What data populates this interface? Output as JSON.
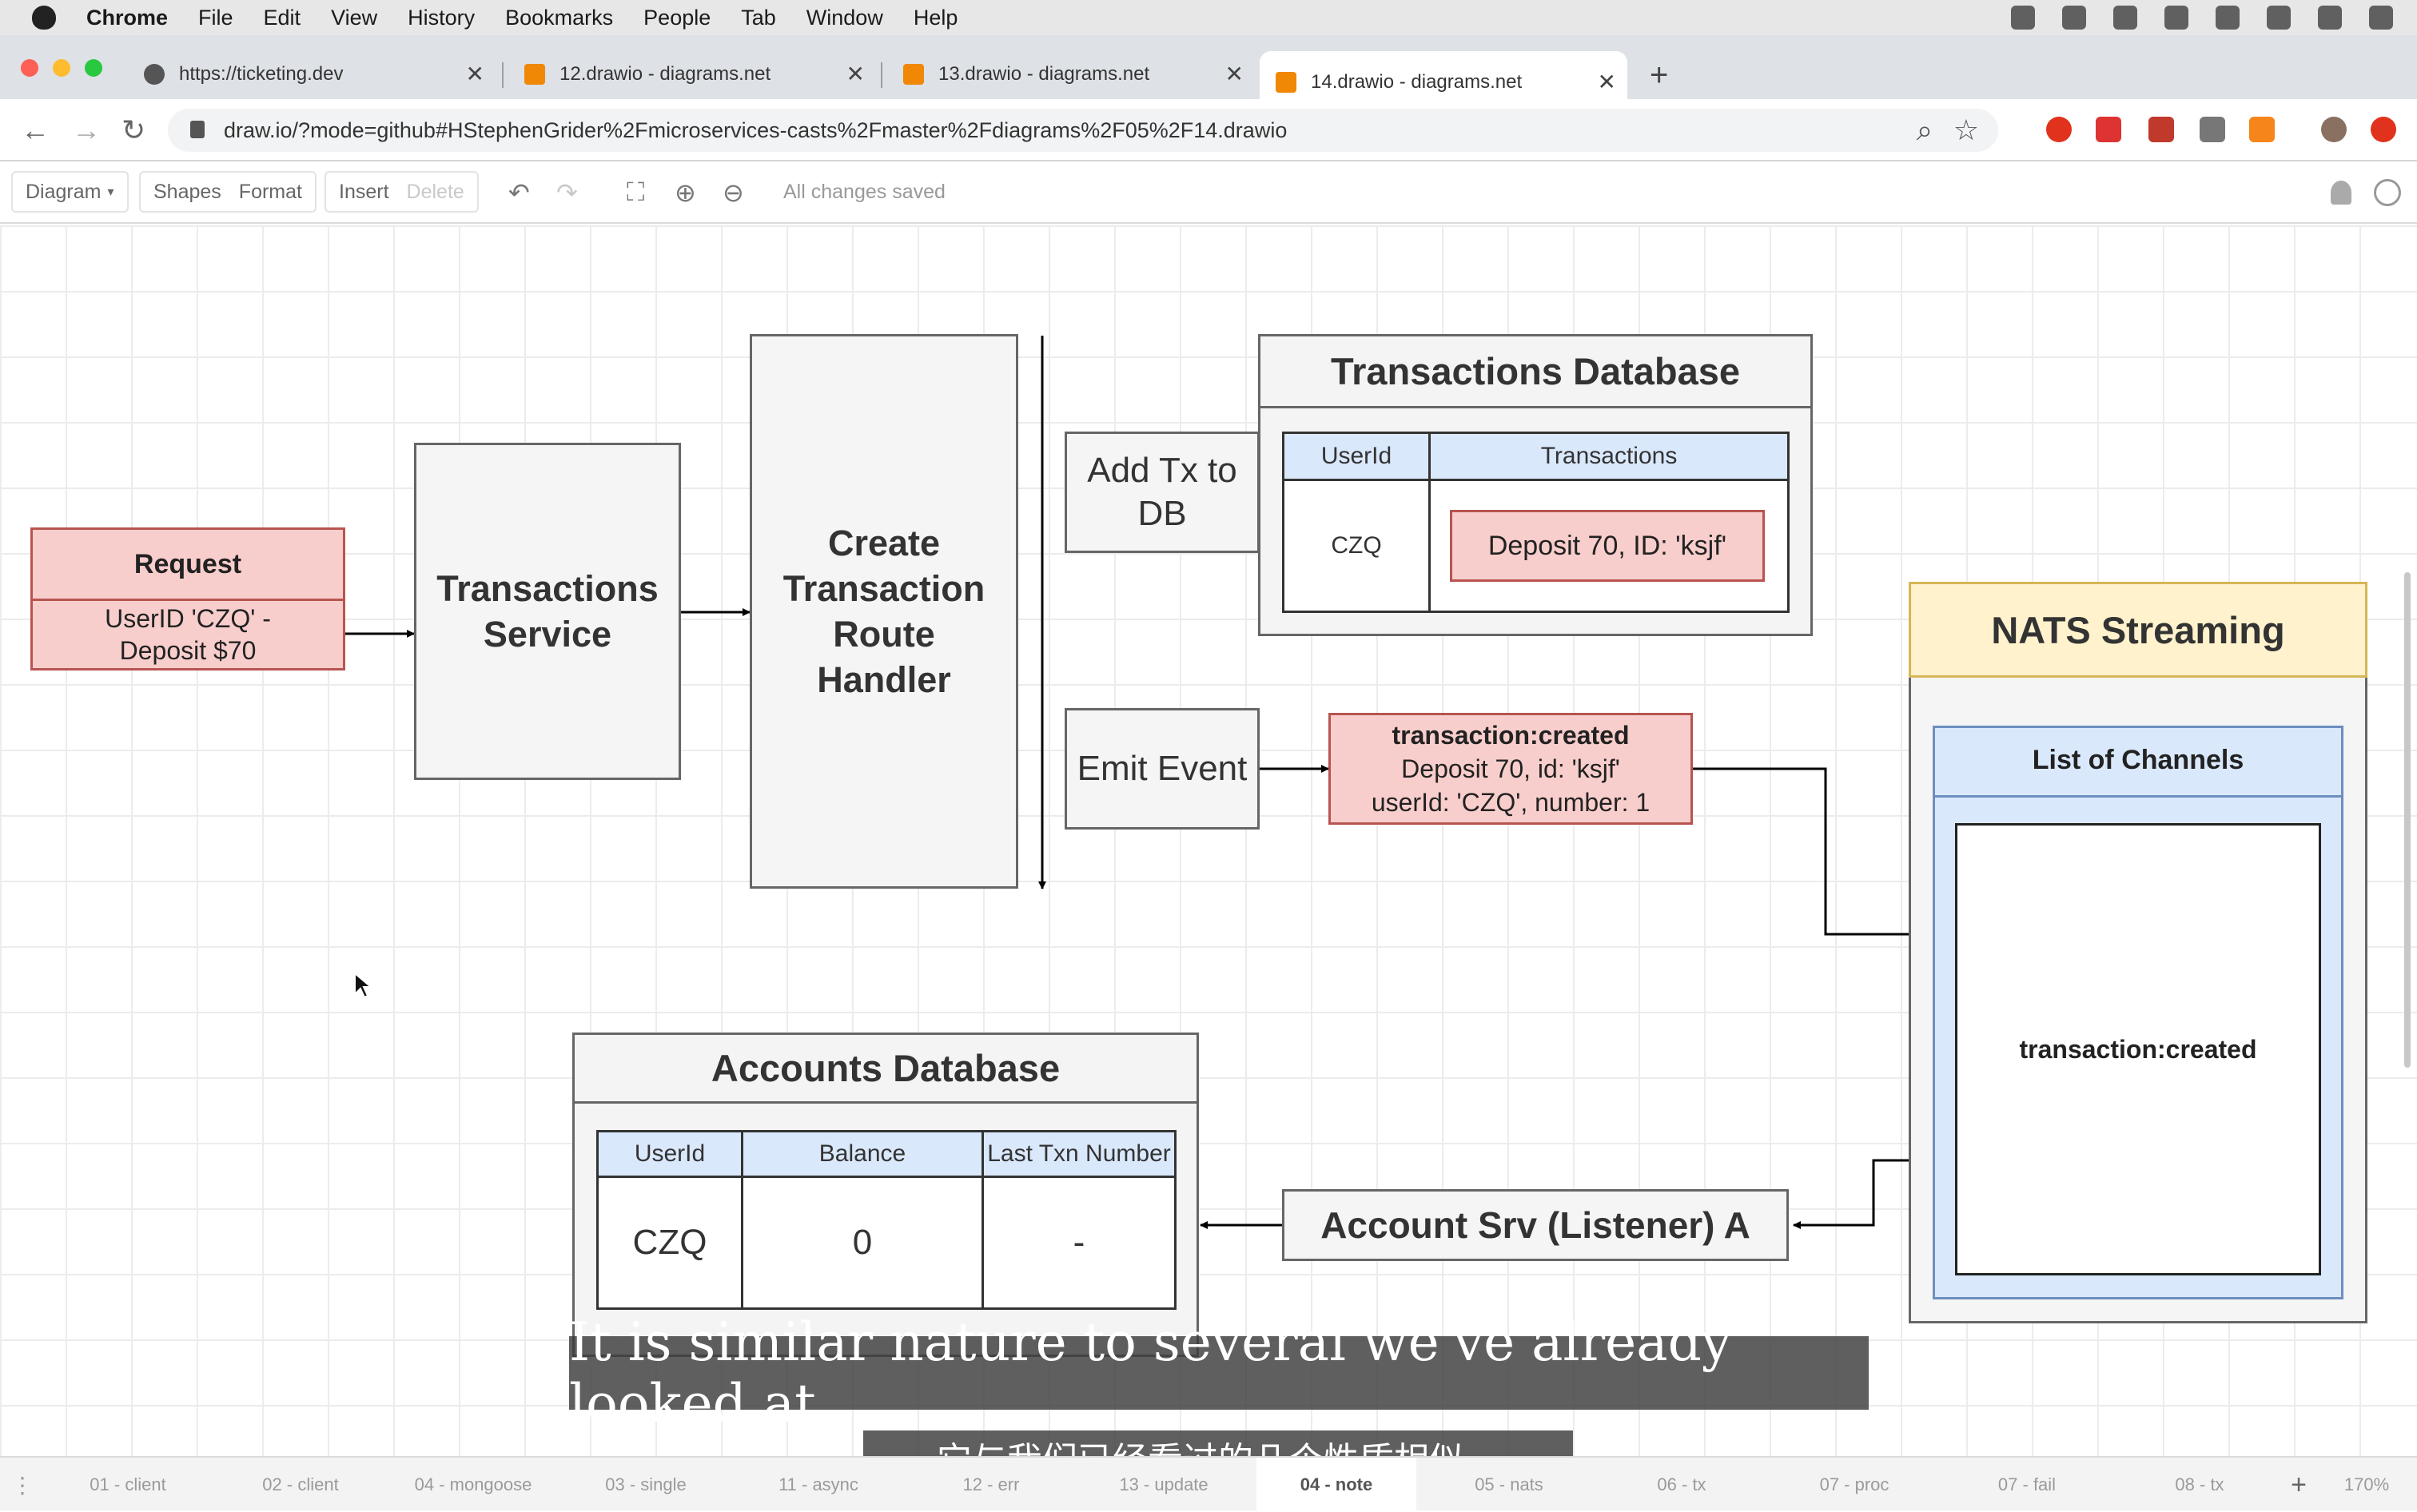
{
  "menubar": {
    "items": [
      "Chrome",
      "File",
      "Edit",
      "View",
      "History",
      "Bookmarks",
      "People",
      "Tab",
      "Window",
      "Help"
    ],
    "tray_icons": [
      "account-badge-icon",
      "cloud-icon",
      "glasses-icon",
      "wifi-icon",
      "battery-icon",
      "spotlight-icon",
      "siri-icon",
      "notification-center-icon"
    ]
  },
  "browser": {
    "tabs": [
      {
        "label": "https://ticketing.dev",
        "favicon": "globe-icon",
        "active": false
      },
      {
        "label": "12.drawio - diagrams.net",
        "favicon": "drawio-icon",
        "active": false
      },
      {
        "label": "13.drawio - diagrams.net",
        "favicon": "drawio-icon",
        "active": false
      },
      {
        "label": "14.drawio - diagrams.net",
        "favicon": "drawio-icon",
        "active": true
      }
    ],
    "close_glyph": "✕",
    "new_tab_glyph": "+",
    "url": "draw.io/?mode=github#HStephenGrider%2Fmicroservices-casts%2Fmaster%2Fdiagrams%2F05%2F14.drawio",
    "back_glyph": "←",
    "forward_glyph": "→",
    "reload_glyph": "↻",
    "zoom_glyph": "⌕",
    "star_glyph": "☆"
  },
  "drawio": {
    "toolbar": {
      "diagram": "Diagram",
      "shapes": "Shapes",
      "format": "Format",
      "insert": "Insert",
      "delete": "Delete",
      "undo_glyph": "↶",
      "redo_glyph": "↷",
      "fullscreen_glyph": "⛶",
      "zoom_in_glyph": "⊕",
      "zoom_out_glyph": "⊖",
      "status": "All changes saved"
    },
    "diagram": {
      "request": {
        "title": "Request",
        "body": "UserID 'CZQ' - Deposit $70"
      },
      "transactions_service": "Transactions Service",
      "route_handler": "Create Transaction Route Handler",
      "add_tx": "Add Tx to DB",
      "emit_event": "Emit Event",
      "transactions_db": {
        "title": "Transactions Database",
        "columns": [
          "UserId",
          "Transactions"
        ],
        "row": {
          "user": "CZQ",
          "entry": "Deposit 70, ID: 'ksjf'"
        }
      },
      "event": {
        "name": "transaction:created",
        "line1": "Deposit 70, id: 'ksjf'",
        "line2": "userId: 'CZQ', number: 1"
      },
      "nats": {
        "title": "NATS Streaming",
        "channels_title": "List of Channels",
        "channel": "transaction:created"
      },
      "accounts_db": {
        "title": "Accounts Database",
        "columns": [
          "UserId",
          "Balance",
          "Last Txn Number"
        ],
        "row": [
          "CZQ",
          "0",
          "-"
        ]
      },
      "account_srv": "Account Srv (Listener) A"
    },
    "pages": [
      "01 - client",
      "02 - client",
      "04 - mongoose",
      "03 - single",
      "11 - async",
      "12 - err",
      "13 - update",
      "04 - note",
      "05 - nats",
      "06 - tx",
      "07 - proc",
      "07 - fail",
      "08 - tx"
    ],
    "active_page": "04 - note",
    "zoom": "170%"
  },
  "subtitles": {
    "english": "It is similar nature to several we've already looked at.",
    "chinese": "它与我们已经看过的几个性质相似。"
  },
  "colors": {
    "red_fill": "#f8cecc",
    "blue_fill": "#dae8fc",
    "yellow_fill": "#fff2cc",
    "accent_drawio": "#f08705"
  }
}
